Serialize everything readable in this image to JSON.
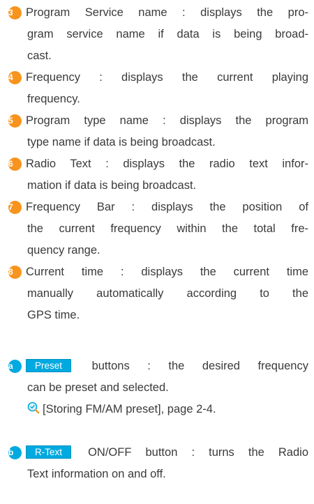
{
  "items": [
    {
      "marker": "3",
      "lines": [
        "Program Service name : displays the pro-",
        "gram service name if data is being broad-",
        "cast."
      ]
    },
    {
      "marker": "4",
      "lines": [
        "Frequency : displays the current playing",
        "frequency."
      ]
    },
    {
      "marker": "5",
      "lines": [
        "Program type name : displays the program",
        "type name if data is being broadcast."
      ]
    },
    {
      "marker": "6",
      "lines": [
        "Radio Text : displays the radio text infor-",
        "mation if data is being broadcast."
      ]
    },
    {
      "marker": "7",
      "lines": [
        "Frequency Bar : displays the position of",
        "the current frequency within the total fre-",
        "quency range."
      ]
    },
    {
      "marker": "8",
      "lines": [
        "Current time : displays the current time",
        "manually automatically according to the",
        "GPS time."
      ]
    }
  ],
  "buttons": [
    {
      "marker": "a",
      "chip": "Preset",
      "first_line_text": "buttons : the desired frequency",
      "second_line": "can be preset and selected.",
      "reference": "[Storing FM/AM preset], page 2-4."
    },
    {
      "marker": "b",
      "chip": "R-Text",
      "first_line_text": "ON/OFF button : turns the Radio",
      "second_line": "Text information on and off."
    }
  ],
  "colors": {
    "number_marker": "#f7941d",
    "letter_marker": "#00a9e0",
    "chip": "#00a9e0",
    "text": "#3a3a3a"
  },
  "icons": {
    "reference": "magnifier-reference-icon"
  }
}
